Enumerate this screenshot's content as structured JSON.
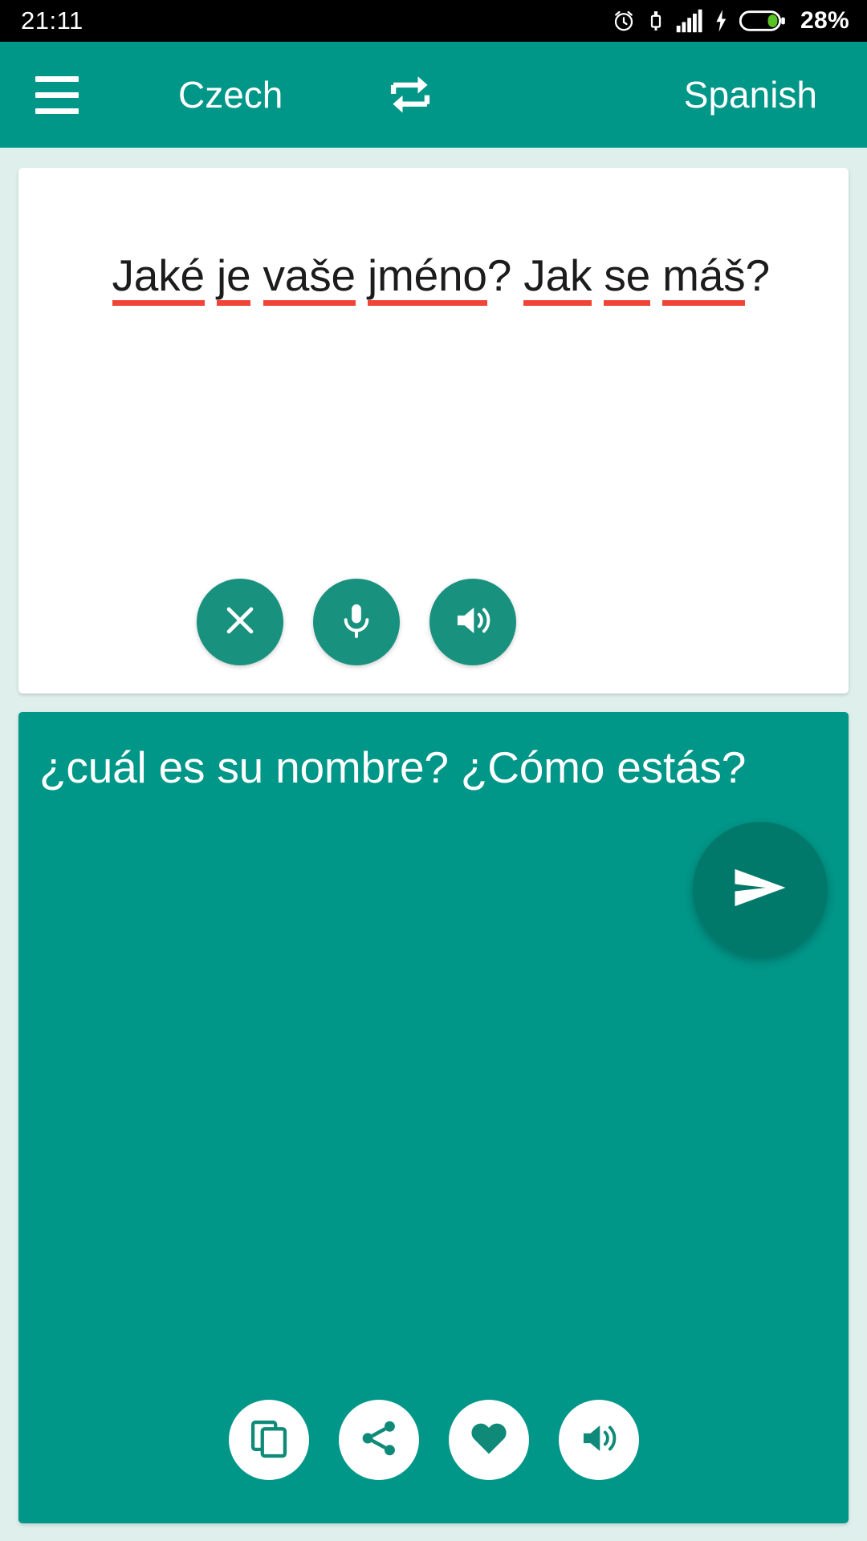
{
  "status_bar": {
    "time": "21:11",
    "battery_percent": "28%",
    "icons": [
      "alarm-clock-icon",
      "usb-lock-icon",
      "signal-bars-icon",
      "charging-bolt-icon",
      "battery-icon"
    ]
  },
  "app_bar": {
    "menu_icon": "hamburger-menu-icon",
    "source_language": "Czech",
    "swap_icon": "swap-languages-icon",
    "target_language": "Spanish",
    "background_color": "#009688"
  },
  "source_card": {
    "text": "Jaké je vaše jméno? Jak se máš?",
    "words": [
      {
        "text": "Jaké",
        "misspelled": true
      },
      {
        "text": "je",
        "misspelled": true
      },
      {
        "text": "vaše",
        "misspelled": true
      },
      {
        "text": "jméno",
        "misspelled": true
      },
      {
        "text": "?",
        "misspelled": false
      },
      {
        "text": "Jak",
        "misspelled": true
      },
      {
        "text": "se",
        "misspelled": true
      },
      {
        "text": "máš",
        "misspelled": true
      },
      {
        "text": "?",
        "misspelled": false
      }
    ],
    "spellcheck_underline_color": "#f04437",
    "background_color": "#ffffff",
    "actions": [
      {
        "name": "clear-button",
        "icon": "close-x-icon"
      },
      {
        "name": "microphone-button",
        "icon": "microphone-icon"
      },
      {
        "name": "speak-source-button",
        "icon": "speaker-icon"
      }
    ]
  },
  "send_button": {
    "icon": "send-arrow-icon",
    "color": "#00796b"
  },
  "target_card": {
    "text": "¿cuál es su nombre? ¿Cómo estás?",
    "background_color": "#009688",
    "actions": [
      {
        "name": "copy-button",
        "icon": "copy-icon"
      },
      {
        "name": "share-button",
        "icon": "share-icon"
      },
      {
        "name": "favorite-button",
        "icon": "heart-icon"
      },
      {
        "name": "speak-target-button",
        "icon": "speaker-icon"
      }
    ]
  }
}
